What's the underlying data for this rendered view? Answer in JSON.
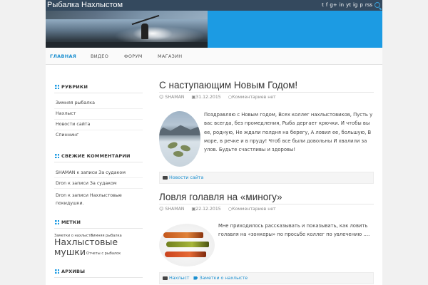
{
  "site": {
    "title": "Рыбалка Нахлыстом"
  },
  "social_icons": [
    "twitter-icon",
    "facebook-icon",
    "google-plus-icon",
    "linkedin-icon",
    "youtube-icon",
    "instagram-icon",
    "pinterest-icon",
    "rss-icon"
  ],
  "social_glyphs": [
    "t",
    "f",
    "g+",
    "in",
    "yt",
    "ig",
    "p",
    "rss"
  ],
  "nav": {
    "items": [
      {
        "label": "ГЛАВНАЯ",
        "active": true
      },
      {
        "label": "ВИДЕО",
        "active": false
      },
      {
        "label": "ФОРУМ",
        "active": false
      },
      {
        "label": "МАГАЗИН",
        "active": false
      }
    ]
  },
  "sidebar": {
    "rubrics": {
      "title": "РУБРИКИ",
      "items": [
        "Зимняя рыбалка",
        "Нахлыст",
        "Новости сайта",
        "Спиннинг"
      ]
    },
    "comments": {
      "title": "СВЕЖИЕ КОММЕНТАРИИ",
      "items": [
        {
          "author": "SHAMAN",
          "text": " к записи За судаком"
        },
        {
          "author": "Dron",
          "text": " к записи За судаком"
        },
        {
          "author": "Dron",
          "text": " к записи Нахлыстовые покидушки."
        }
      ]
    },
    "tags": {
      "title": "МЕТКИ",
      "items": [
        "Заметки о нахлысте",
        "Зимняя рыбалка",
        "Нахлыстовые мушки",
        "Отчеты с рыбалок"
      ]
    },
    "archives": {
      "title": "АРХИВЫ"
    }
  },
  "posts": [
    {
      "title": "С наступающим Новым Годом!",
      "author": "SHAMAN",
      "date": "31.12.2015",
      "comments": "Комментариев нет",
      "excerpt_lines": [
        "Поздравляю с Новым годом, Всех коллег нахлыстовиков, Пусть у",
        "вас всегда, без промедления, Рыба дергает крючки. И чтобы вы",
        "ее, родную, Не ждали полдня на берегу, А ловил ее, большую, В",
        "море, в речке и в пруду! Чтоб все были довольны И хвалили за",
        "улов. Будьте счастливы и здоровы!"
      ],
      "category": "Новости сайта"
    },
    {
      "title": "Ловля голавля на «миногу»",
      "author": "SHAMAN",
      "date": "22.12.2015",
      "comments": "Комментариев нет",
      "excerpt_lines": [
        "Мне приходилось рассказывать и показывать, как ловить",
        "голавля на «зонкеры» по просьбе коллег по увлечению …."
      ],
      "category": "Нахлыст",
      "tag": "Заметки о нахлысте"
    }
  ],
  "colors": {
    "accent": "#1c9be3",
    "topbar": "#34495e",
    "link": "#1a8fd0"
  }
}
